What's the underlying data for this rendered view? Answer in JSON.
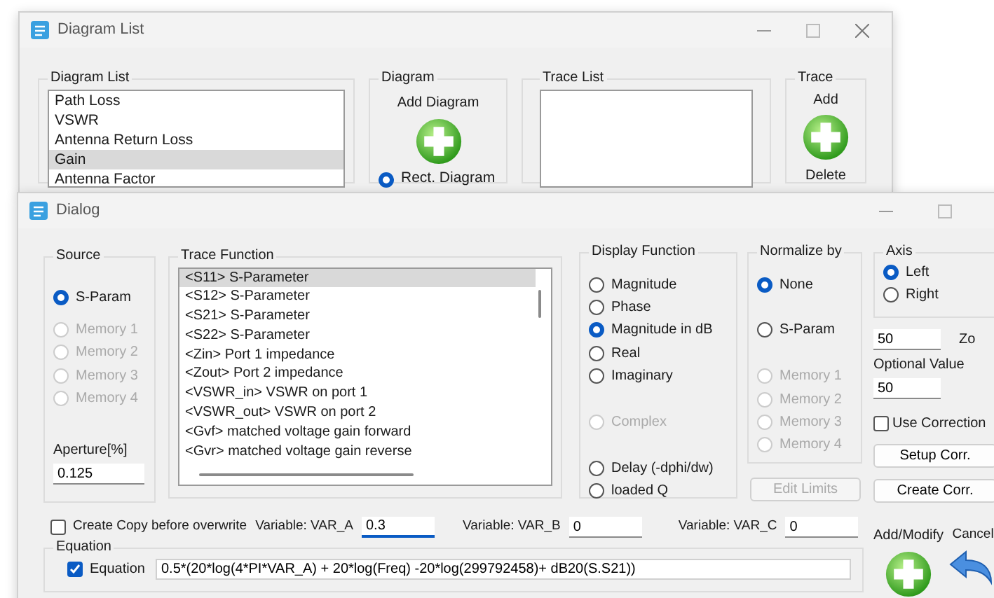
{
  "background_window": {
    "title": "Diagram List",
    "diagram_list": {
      "label": "Diagram List",
      "items": [
        {
          "text": "Path Loss",
          "selected": false
        },
        {
          "text": "VSWR",
          "selected": false
        },
        {
          "text": "Antenna Return Loss",
          "selected": false
        },
        {
          "text": "Gain",
          "selected": true
        },
        {
          "text": "Antenna Factor",
          "selected": false
        }
      ]
    },
    "diagram_group": {
      "label": "Diagram",
      "add_label": "Add Diagram",
      "options": [
        {
          "label": "Rect. Diagram",
          "selected": true
        }
      ]
    },
    "trace_list": {
      "label": "Trace List"
    },
    "trace_group": {
      "label": "Trace",
      "add_label": "Add",
      "delete_label": "Delete"
    }
  },
  "dialog": {
    "title": "Dialog",
    "source": {
      "label": "Source",
      "options": [
        {
          "label": "S-Param",
          "selected": true,
          "disabled": false
        },
        {
          "label": "Memory 1",
          "selected": false,
          "disabled": true
        },
        {
          "label": "Memory 2",
          "selected": false,
          "disabled": true
        },
        {
          "label": "Memory 3",
          "selected": false,
          "disabled": true
        },
        {
          "label": "Memory 4",
          "selected": false,
          "disabled": true
        }
      ]
    },
    "aperture": {
      "label": "Aperture[%]",
      "value": "0.125"
    },
    "trace_function": {
      "label": "Trace Function",
      "items": [
        {
          "text": "<S11> S-Parameter",
          "selected": true
        },
        {
          "text": "<S12> S-Parameter",
          "selected": false
        },
        {
          "text": "<S21> S-Parameter",
          "selected": false
        },
        {
          "text": "<S22> S-Parameter",
          "selected": false
        },
        {
          "text": "<Zin> Port 1 impedance",
          "selected": false
        },
        {
          "text": "<Zout> Port 2 impedance",
          "selected": false
        },
        {
          "text": "<VSWR_in> VSWR on port 1",
          "selected": false
        },
        {
          "text": "<VSWR_out> VSWR on port 2",
          "selected": false
        },
        {
          "text": "<Gvf> matched voltage gain forward",
          "selected": false
        },
        {
          "text": "<Gvr> matched voltage gain reverse",
          "selected": false
        }
      ]
    },
    "display_function": {
      "label": "Display Function",
      "options": [
        {
          "label": "Magnitude",
          "selected": false,
          "disabled": false
        },
        {
          "label": "Phase",
          "selected": false,
          "disabled": false
        },
        {
          "label": "Magnitude in dB",
          "selected": true,
          "disabled": false
        },
        {
          "label": "Real",
          "selected": false,
          "disabled": false
        },
        {
          "label": "Imaginary",
          "selected": false,
          "disabled": false
        },
        {
          "label": "Complex",
          "selected": false,
          "disabled": true
        },
        {
          "label": "Delay (-dphi/dw)",
          "selected": false,
          "disabled": false
        },
        {
          "label": "loaded Q",
          "selected": false,
          "disabled": false
        }
      ]
    },
    "normalize_by": {
      "label": "Normalize by",
      "options": [
        {
          "label": "None",
          "selected": true,
          "disabled": false
        },
        {
          "label": "S-Param",
          "selected": false,
          "disabled": false
        },
        {
          "label": "Memory 1",
          "selected": false,
          "disabled": true
        },
        {
          "label": "Memory 2",
          "selected": false,
          "disabled": true
        },
        {
          "label": "Memory 3",
          "selected": false,
          "disabled": true
        },
        {
          "label": "Memory 4",
          "selected": false,
          "disabled": true
        }
      ]
    },
    "edit_limits": {
      "label": "Edit Limits",
      "disabled": true
    },
    "axis": {
      "label": "Axis",
      "options": [
        {
          "label": "Left",
          "selected": true,
          "disabled": false
        },
        {
          "label": "Right",
          "selected": false,
          "disabled": false
        }
      ]
    },
    "zo": {
      "value": "50",
      "label": "Zo"
    },
    "optional_value": {
      "label": "Optional Value",
      "value": "50"
    },
    "use_correction": {
      "label": "Use Correction",
      "checked": false
    },
    "buttons": [
      {
        "label": "Setup Corr."
      },
      {
        "label": "Create Corr."
      }
    ],
    "create_copy": {
      "label": "Create Copy before overwrite",
      "checked": false
    },
    "variables": [
      {
        "label": "Variable: VAR_A",
        "value": "0.3",
        "focused": true
      },
      {
        "label": "Variable: VAR_B",
        "value": "0",
        "focused": false
      },
      {
        "label": "Variable: VAR_C",
        "value": "0",
        "focused": false
      }
    ],
    "equation": {
      "group_label": "Equation",
      "label": "Equation",
      "checked": true,
      "value": "0.5*(20*log(4*PI*VAR_A) + 20*log(Freq) -20*log(299792458)+ dB20(S.S21))"
    },
    "add_modify": {
      "label": "Add/Modify"
    },
    "cancel": {
      "label": "Cancel"
    }
  }
}
